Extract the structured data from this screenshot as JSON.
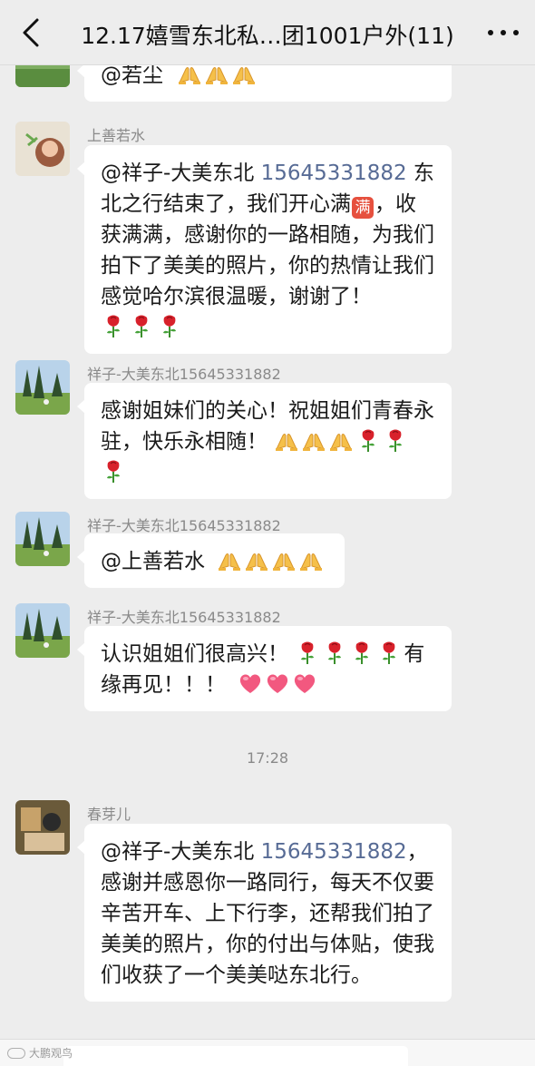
{
  "header": {
    "title": "12.17嬉雪东北私…团1001户外(11)"
  },
  "messages": {
    "m0": {
      "text_a": "@若尘"
    },
    "m1": {
      "sender": "上善若水",
      "mention": "@祥子-大美东北",
      "phone": "15645331882",
      "text_a": "东北之行结束了，我们开心满",
      "emoji_man": "满",
      "text_b": "，收获满满，感谢你的一路相随，为我们拍下了美美的照片，你的热情让我们感觉哈尔滨很温暖，谢谢了！"
    },
    "m2": {
      "sender": "祥子-大美东北15645331882",
      "text_a": "感谢姐妹们的关心！祝姐姐们青春永驻，快乐永相随！"
    },
    "m3": {
      "sender": "祥子-大美东北15645331882",
      "text_a": "@上善若水"
    },
    "m4": {
      "sender": "祥子-大美东北15645331882",
      "text_a": "认识姐姐们很高兴！",
      "text_b": "有缘再见！！！"
    },
    "timestamp": "17:28",
    "m5": {
      "sender": "春芽儿",
      "mention": "@祥子-大美东北",
      "phone": "15645331882",
      "text_a": "，感谢并感恩你一路同行，每天不仅要辛苦开车、上下行李，还帮我们拍了美美的照片，你的付出与体贴，使我们收获了一个美美哒东北行。"
    }
  },
  "watermark": {
    "text": "大鹏观鸟"
  },
  "colors": {
    "background": "#ededed",
    "bubble": "#ffffff",
    "link": "#576b95",
    "sender": "#8a8a8a"
  },
  "icons": {
    "back": "chevron-left-icon",
    "more": "ellipsis-icon",
    "pray": "folded-hands-emoji",
    "rose": "rose-emoji",
    "heart": "pink-heart-emoji"
  }
}
